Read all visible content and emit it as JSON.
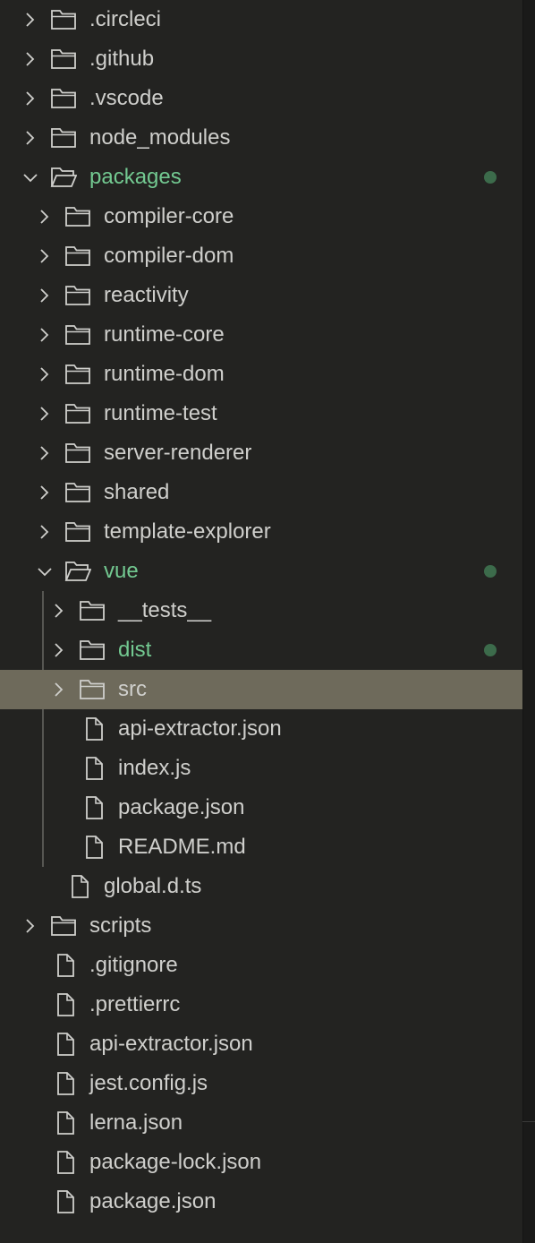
{
  "explorer": {
    "items": [
      {
        "label": ".circleci",
        "type": "folder",
        "expanded": false,
        "depth": 0
      },
      {
        "label": ".github",
        "type": "folder",
        "expanded": false,
        "depth": 0
      },
      {
        "label": ".vscode",
        "type": "folder",
        "expanded": false,
        "depth": 0
      },
      {
        "label": "node_modules",
        "type": "folder",
        "expanded": false,
        "depth": 0
      },
      {
        "label": "packages",
        "type": "folder",
        "expanded": true,
        "depth": 0,
        "modified": true
      },
      {
        "label": "compiler-core",
        "type": "folder",
        "expanded": false,
        "depth": 1
      },
      {
        "label": "compiler-dom",
        "type": "folder",
        "expanded": false,
        "depth": 1
      },
      {
        "label": "reactivity",
        "type": "folder",
        "expanded": false,
        "depth": 1
      },
      {
        "label": "runtime-core",
        "type": "folder",
        "expanded": false,
        "depth": 1
      },
      {
        "label": "runtime-dom",
        "type": "folder",
        "expanded": false,
        "depth": 1
      },
      {
        "label": "runtime-test",
        "type": "folder",
        "expanded": false,
        "depth": 1
      },
      {
        "label": "server-renderer",
        "type": "folder",
        "expanded": false,
        "depth": 1
      },
      {
        "label": "shared",
        "type": "folder",
        "expanded": false,
        "depth": 1
      },
      {
        "label": "template-explorer",
        "type": "folder",
        "expanded": false,
        "depth": 1
      },
      {
        "label": "vue",
        "type": "folder",
        "expanded": true,
        "depth": 1,
        "modified": true
      },
      {
        "label": "__tests__",
        "type": "folder",
        "expanded": false,
        "depth": 2
      },
      {
        "label": "dist",
        "type": "folder",
        "expanded": false,
        "depth": 2,
        "modified": true
      },
      {
        "label": "src",
        "type": "folder",
        "expanded": false,
        "depth": 2,
        "selected": true
      },
      {
        "label": "api-extractor.json",
        "type": "file",
        "depth": 2
      },
      {
        "label": "index.js",
        "type": "file",
        "depth": 2
      },
      {
        "label": "package.json",
        "type": "file",
        "depth": 2
      },
      {
        "label": "README.md",
        "type": "file",
        "depth": 2
      },
      {
        "label": "global.d.ts",
        "type": "file",
        "depth": 1
      },
      {
        "label": "scripts",
        "type": "folder",
        "expanded": false,
        "depth": 0
      },
      {
        "label": ".gitignore",
        "type": "file",
        "depth": 0
      },
      {
        "label": ".prettierrc",
        "type": "file",
        "depth": 0
      },
      {
        "label": "api-extractor.json",
        "type": "file",
        "depth": 0
      },
      {
        "label": "jest.config.js",
        "type": "file",
        "depth": 0
      },
      {
        "label": "lerna.json",
        "type": "file",
        "depth": 0
      },
      {
        "label": "package-lock.json",
        "type": "file",
        "depth": 0
      },
      {
        "label": "package.json",
        "type": "file",
        "depth": 0
      }
    ]
  },
  "colors": {
    "background": "#232321",
    "text": "#cfcfcc",
    "modified_text": "#73c991",
    "modified_dot": "#3c6b4b",
    "selection": "#6e6a5b",
    "icon_stroke": "#cfcfcc"
  },
  "icons": {
    "collapsed_chevron": "chevron-right-icon",
    "expanded_chevron": "chevron-down-icon",
    "folder_closed": "folder-icon",
    "folder_open": "folder-open-icon",
    "file": "file-icon",
    "modified_indicator": "modified-dot-icon"
  }
}
